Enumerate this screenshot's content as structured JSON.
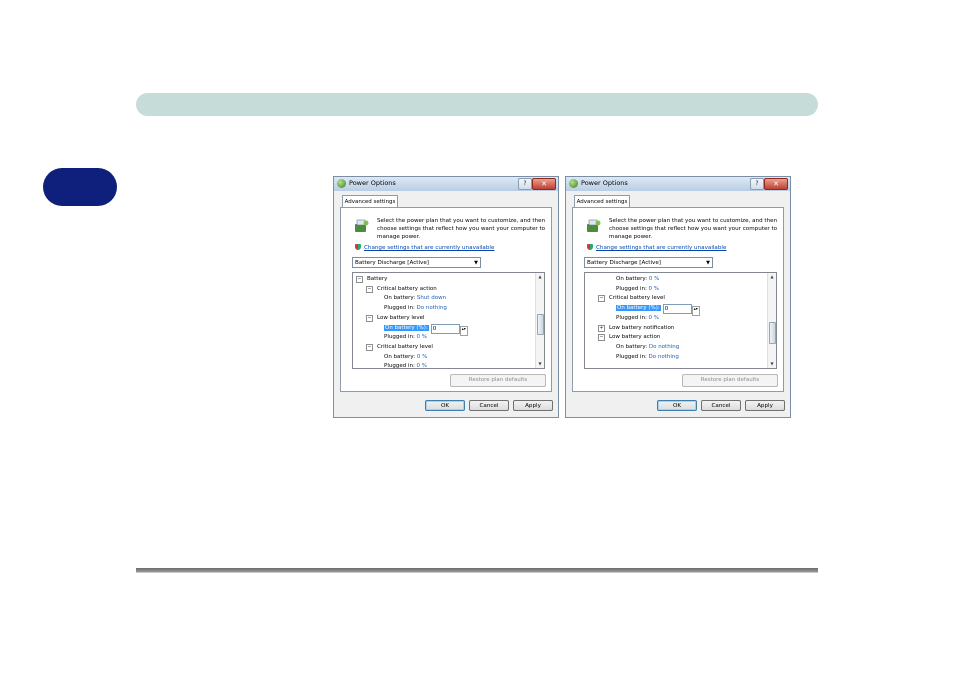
{
  "dialogs": [
    {
      "title": "Power Options",
      "help": "?",
      "close": "✕",
      "tab": "Advanced settings",
      "description": "Select the power plan that you want to customize, and then choose settings that reflect how you want your computer to manage power.",
      "link": "Change settings that are currently unavailable",
      "plan": "Battery Discharge [Active]",
      "tree": [
        {
          "indent": 0,
          "exp": "⊟",
          "label": "Battery",
          "value": ""
        },
        {
          "indent": 1,
          "exp": "⊟",
          "label": "Critical battery action",
          "value": ""
        },
        {
          "indent": 2,
          "exp": "",
          "label": "On battery:",
          "value": "Shut down"
        },
        {
          "indent": 2,
          "exp": "",
          "label": "Plugged in:",
          "value": "Do nothing"
        },
        {
          "indent": 1,
          "exp": "⊟",
          "label": "Low battery level",
          "value": ""
        },
        {
          "indent": 2,
          "exp": "",
          "label": "On battery (%):",
          "value": "0",
          "selected": true
        },
        {
          "indent": 2,
          "exp": "",
          "label": "Plugged in:",
          "value": "0 %"
        },
        {
          "indent": 1,
          "exp": "⊟",
          "label": "Critical battery level",
          "value": ""
        },
        {
          "indent": 2,
          "exp": "",
          "label": "On battery:",
          "value": "0 %"
        },
        {
          "indent": 2,
          "exp": "",
          "label": "Plugged in:",
          "value": "0 %"
        }
      ],
      "scroll": {
        "position": 0.55,
        "size": 0.25
      },
      "restore": "Restore plan defaults",
      "ok": "OK",
      "cancel": "Cancel",
      "apply": "Apply"
    },
    {
      "title": "Power Options",
      "help": "?",
      "close": "✕",
      "tab": "Advanced settings",
      "description": "Select the power plan that you want to customize, and then choose settings that reflect how you want your computer to manage power.",
      "link": "Change settings that are currently unavailable",
      "plan": "Battery Discharge [Active]",
      "tree": [
        {
          "indent": 2,
          "exp": "",
          "label": "On battery:",
          "value": "0 %"
        },
        {
          "indent": 2,
          "exp": "",
          "label": "Plugged in:",
          "value": "0 %"
        },
        {
          "indent": 1,
          "exp": "⊟",
          "label": "Critical battery level",
          "value": ""
        },
        {
          "indent": 2,
          "exp": "",
          "label": "On battery (%):",
          "value": "0",
          "selected": true
        },
        {
          "indent": 2,
          "exp": "",
          "label": "Plugged in:",
          "value": "0 %"
        },
        {
          "indent": 1,
          "exp": "⊞",
          "label": "Low battery notification",
          "value": ""
        },
        {
          "indent": 1,
          "exp": "⊟",
          "label": "Low battery action",
          "value": ""
        },
        {
          "indent": 2,
          "exp": "",
          "label": "On battery:",
          "value": "Do nothing"
        },
        {
          "indent": 2,
          "exp": "",
          "label": "Plugged in:",
          "value": "Do nothing"
        }
      ],
      "scroll": {
        "position": 0.7,
        "size": 0.25
      },
      "restore": "Restore plan defaults",
      "ok": "OK",
      "cancel": "Cancel",
      "apply": "Apply"
    }
  ],
  "colors": {
    "header_bar": "#c5dcd8",
    "side_tab": "#0f1f7c",
    "value_text": "#1f5fb8",
    "selection": "#3399ff"
  }
}
